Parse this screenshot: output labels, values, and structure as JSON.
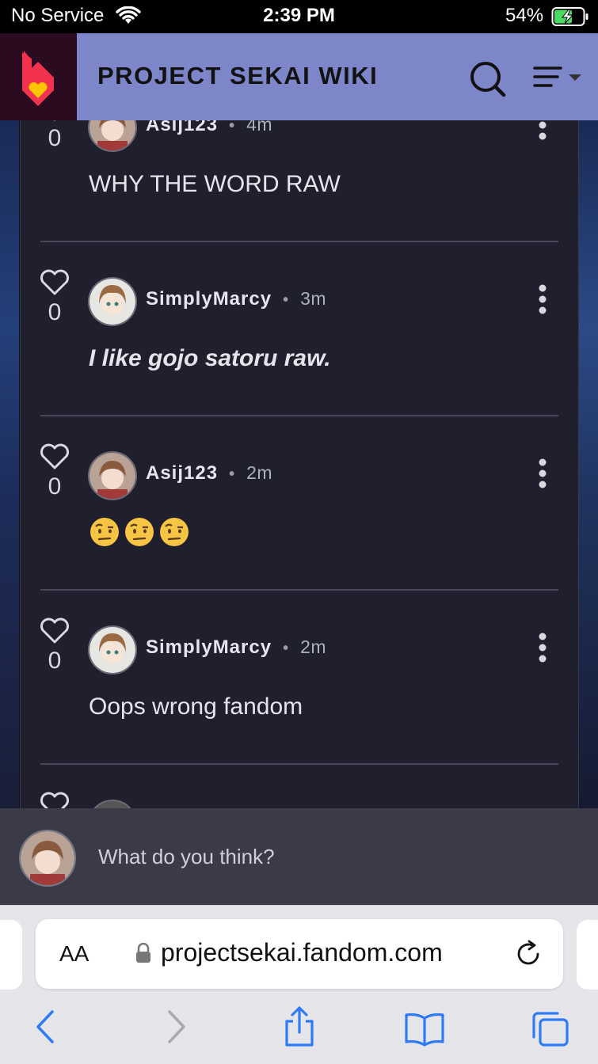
{
  "status_bar": {
    "carrier": "No Service",
    "time": "2:39 PM",
    "battery_percent": "54%"
  },
  "header": {
    "site_title": "PROJECT SEKAI WIKI",
    "logo_icon": "fandom-heart-flame-icon",
    "search_icon": "search-icon",
    "menu_icon": "hamburger-menu-icon"
  },
  "comments": [
    {
      "likes": "0",
      "author": "Asij123",
      "time": "4m",
      "body": "WHY THE WORD RAW",
      "style": "normal"
    },
    {
      "likes": "0",
      "author": "SimplyMarcy",
      "time": "3m",
      "body": "I like gojo satoru raw.",
      "style": "bold-italic"
    },
    {
      "likes": "0",
      "author": "Asij123",
      "time": "2m",
      "body": "",
      "emojis": [
        "face-with-raised-eyebrow",
        "face-with-raised-eyebrow",
        "face-with-raised-eyebrow"
      ],
      "style": "emoji"
    },
    {
      "likes": "0",
      "author": "SimplyMarcy",
      "time": "2m",
      "body": "Oops wrong fandom",
      "style": "normal"
    }
  ],
  "separator": "•",
  "reply": {
    "placeholder": "What do you think?"
  },
  "browser": {
    "text_size_label": "AA",
    "url": "projectsekai.fandom.com",
    "toolbar_icons": [
      "back-icon",
      "forward-icon",
      "share-icon",
      "bookmarks-icon",
      "tabs-icon"
    ]
  },
  "colors": {
    "header_bg": "#7c86c8",
    "panel_bg": "#1f1f2e",
    "logo_red": "#f2334e",
    "logo_yellow": "#ffc500",
    "safari_blue": "#2f7bf5"
  }
}
